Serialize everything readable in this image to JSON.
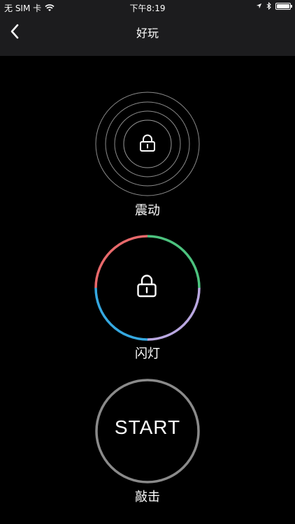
{
  "status_bar": {
    "carrier": "无 SIM 卡",
    "time": "下午8:19",
    "icons": [
      "wifi-icon",
      "location-arrow-icon",
      "bluetooth-icon",
      "battery-icon"
    ]
  },
  "nav": {
    "back_icon": "chevron-left-icon",
    "title": "好玩"
  },
  "features": [
    {
      "id": "vibration",
      "label": "震动",
      "icon": "lock-icon",
      "locked": true
    },
    {
      "id": "flash",
      "label": "闪灯",
      "icon": "lock-icon",
      "locked": true
    },
    {
      "id": "knock",
      "label": "敲击",
      "button_text": "START"
    }
  ],
  "colors": {
    "background": "#000000",
    "bar": "#1c1c1e",
    "ring_red": "#e8696b",
    "ring_green": "#4cc27e",
    "ring_purple": "#b9a7e0",
    "ring_blue": "#35a8e0",
    "start_ring": "#8a8a8a"
  }
}
